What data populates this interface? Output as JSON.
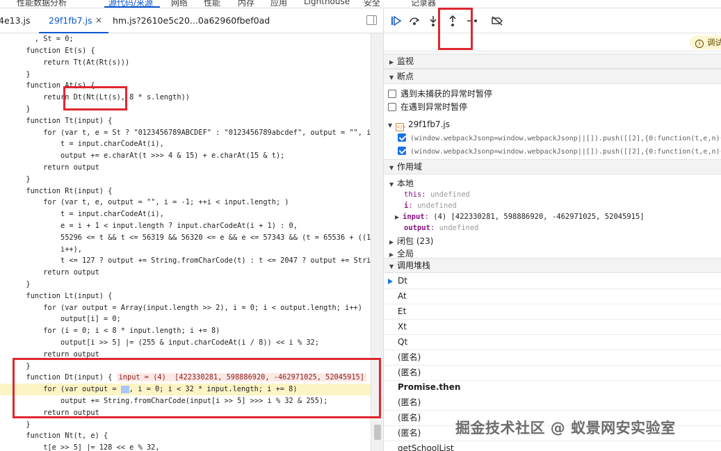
{
  "top_tabs": [
    "性能数据分析",
    "源代码/来源",
    "网络",
    "性能",
    "内存",
    "应用",
    "Lighthouse",
    "安全",
    "记录器"
  ],
  "file_tabs": {
    "left_partial": "4e13.js",
    "active": "29f1fb7.js",
    "third": "hm.js?2610e5c20...0a62960fbef0ad",
    "close_glyph": "×"
  },
  "code_lines": [
    "    , St = 0;",
    "  function Et(s) {",
    "      return Tt(At(Rt(s)))",
    "  }",
    "  function At(s) {",
    "      return Dt(Nt(Lt(s), 8 * s.length))",
    "  }",
    "  function Tt(input) {",
    "      for (var t, e = St ? \"0123456789ABCDEF\" : \"0123456789abcdef\", output = \"\", i =",
    "          t = input.charCodeAt(i),",
    "          output += e.charAt(t >>> 4 & 15) + e.charAt(15 & t);",
    "      return output",
    "  }",
    "  function Rt(input) {",
    "      for (var t, e, output = \"\", i = -1; ++i < input.length; )",
    "          t = input.charCodeAt(i),",
    "          e = i + 1 < input.length ? input.charCodeAt(i + 1) : 0,",
    "          55296 <= t && t <= 56319 && 56320 <= e && e <= 57343 && (t = 65536 + ((102",
    "          i++),",
    "          t <= 127 ? output += String.fromCharCode(t) : t <= 2047 ? output += Strin",
    "      return output",
    "  }",
    "  function Lt(input) {",
    "      for (var output = Array(input.length >> 2), i = 0; i < output.length; i++)",
    "          output[i] = 0;",
    "      for (i = 0; i < 8 * input.length; i += 8)",
    "          output[i >> 5] |= (255 & input.charCodeAt(i / 8)) << i % 32;",
    "      return output",
    "  }",
    "  function Dt(input) {",
    "      for (var output = ",
    "          output += String.fromCharCode(input[i >> 5] >>> i % 32 & 255);",
    "      return output",
    "  }",
    "  function Nt(t, e) {",
    "      t[e >> 5] |= 128 << e % 32,"
  ],
  "inline_values": {
    "dt_input": "input = (4)  [422330281, 598886920, -462971025, 52045915]",
    "for_rest": ", i = 0; i < 32 * input.length; i += 8)"
  },
  "debugger": {
    "notice": "调试",
    "notice_icon": "i",
    "sections": {
      "watch": "监视",
      "breakpoints": "断点",
      "scope": "作用域",
      "call_stack": "调用堆栈"
    },
    "bp_options": [
      {
        "label": "遇到未捕获的异常时暂停",
        "checked": false
      },
      {
        "label": "在遇到异常时暂停",
        "checked": false
      }
    ],
    "bp_file": "29f1fb7.js",
    "bp_entries": [
      "(window.webpackJsonp=window.webpackJsonp||[]).push([[2],{0:function(t,e,n){",
      "(window.webpackJsonp=window.webpackJsonp||[]).push([[2],{0:function(t,e,n){"
    ],
    "scope": {
      "local": "本地",
      "this_key": "this",
      "this_val": "undefined",
      "i_key": "i",
      "i_val": "undefined",
      "input_key": "input",
      "input_val": "(4)  [422330281, 598886920, -462971025, 52045915]",
      "output_key": "output",
      "output_val": "undefined",
      "closure": "闭包 (23)",
      "global": "全局"
    },
    "call_stack": [
      "Dt",
      "At",
      "Et",
      "Xt",
      "Qt",
      "(匿名)",
      "(匿名)",
      "Promise.then",
      "(匿名)",
      "(匿名)",
      "(匿名)",
      "getSchoolList"
    ]
  },
  "watermark": "掘金技术社区 @ 蚁景网安实验室",
  "colors": {
    "accent": "#0b57d0",
    "highlight_line": "#fdf4c6",
    "annotation_red": "#e0262f"
  }
}
